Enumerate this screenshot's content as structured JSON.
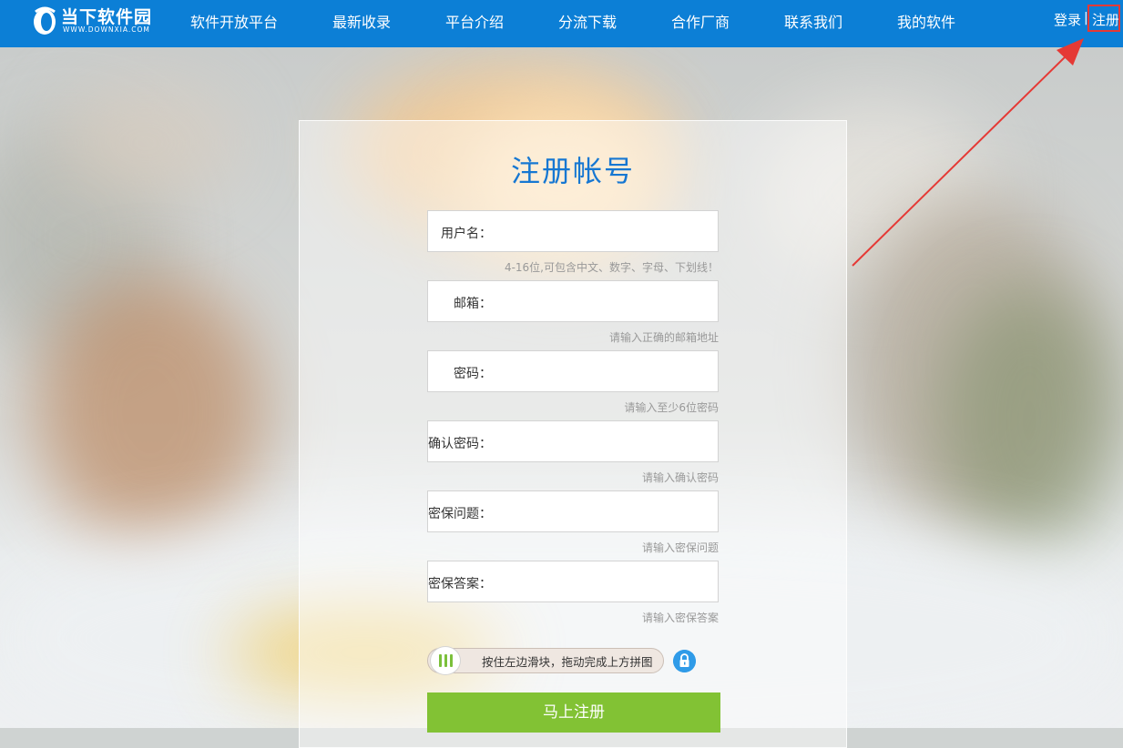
{
  "header": {
    "logo_text": "当下软件园",
    "logo_sub": "WWW.DOWNXIA.COM",
    "nav": [
      {
        "label": "软件开放平台"
      },
      {
        "label": "最新收录"
      },
      {
        "label": "平台介绍"
      },
      {
        "label": "分流下载"
      },
      {
        "label": "合作厂商"
      },
      {
        "label": "联系我们"
      },
      {
        "label": "我的软件"
      }
    ],
    "login": "登录",
    "separator": "|",
    "register": "注册"
  },
  "form": {
    "title": "注册帐号",
    "fields": [
      {
        "label": "用户名：",
        "value": "",
        "hint": "4-16位,可包含中文、数字、字母、下划线！"
      },
      {
        "label": "邮箱：",
        "value": "",
        "hint": "请输入正确的邮箱地址"
      },
      {
        "label": "密码：",
        "value": "",
        "hint": "请输入至少6位密码"
      },
      {
        "label": "确认密码：",
        "value": "",
        "hint": "请输入确认密码"
      },
      {
        "label": "密保问题：",
        "value": "",
        "hint": "请输入密保问题"
      },
      {
        "label": "密保答案：",
        "value": "",
        "hint": "请输入密保答案"
      }
    ],
    "slider_text": "按住左边滑块，拖动完成上方拼图",
    "submit_label": "马上注册"
  },
  "colors": {
    "header_bg": "#0c7fd6",
    "title": "#1677d2",
    "submit_bg": "#82c234",
    "highlight": "#e53935"
  },
  "icons": [
    "logo-mark-icon",
    "slider-grip-icon",
    "lock-icon",
    "annotation-arrow-icon"
  ]
}
